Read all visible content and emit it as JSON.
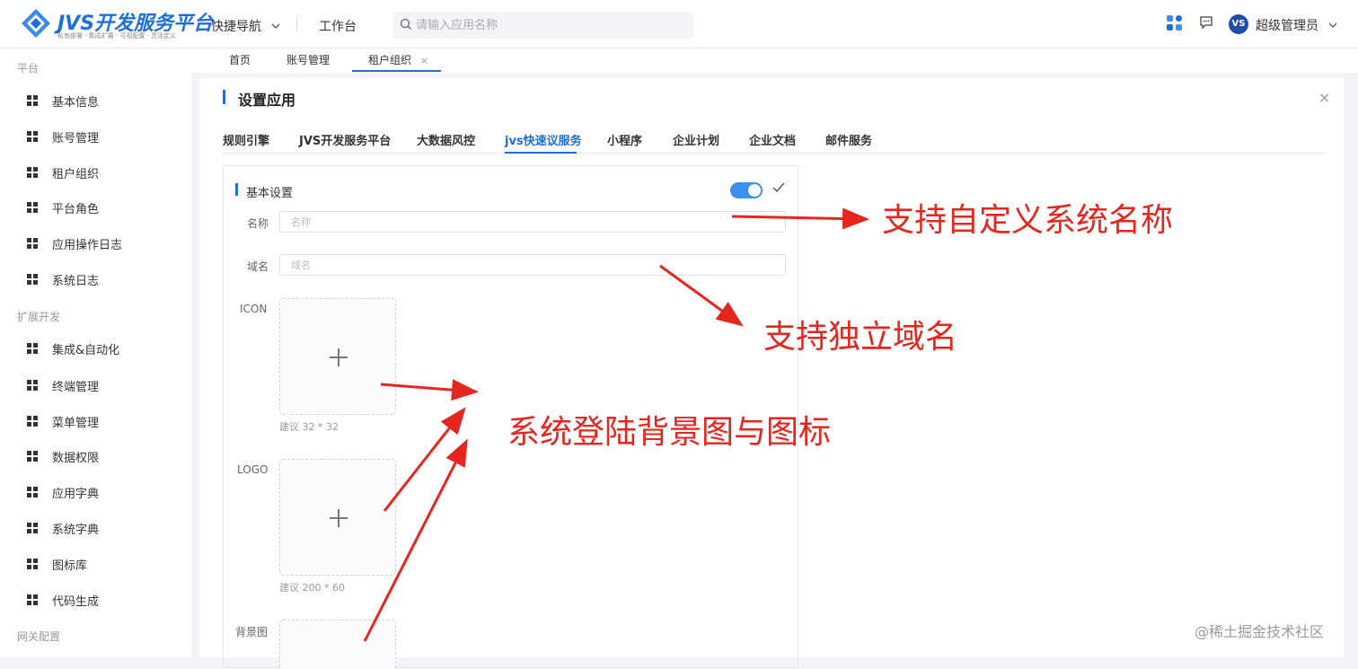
{
  "header": {
    "logo_title": "JVS开发服务平台",
    "logo_subtitle": "私有部署 · 集成扩展 · 可视配置 · 灵活定义",
    "quick_nav": "快捷导航",
    "workbench": "工作台",
    "search_placeholder": "请输入应用名称",
    "avatar_text": "VS",
    "username": "超级管理员"
  },
  "sidebar": {
    "groups": [
      "平台",
      "扩展开发",
      "网关配置"
    ],
    "items": [
      "基本信息",
      "账号管理",
      "租户组织",
      "平台角色",
      "应用操作日志",
      "系统日志",
      "集成&自动化",
      "终端管理",
      "菜单管理",
      "数据权限",
      "应用字典",
      "系统字典",
      "图标库",
      "代码生成"
    ]
  },
  "page_tabs": [
    "首页",
    "账号管理",
    "租户组织"
  ],
  "page_tab_close": "×",
  "panel": {
    "title": "设置应用",
    "close": "×",
    "app_tabs": [
      "规则引擎",
      "JVS开发服务平台",
      "大数据风控",
      "jvs快速议服务",
      "小程序",
      "企业计划",
      "企业文档",
      "邮件服务"
    ],
    "active_tab_index": 3
  },
  "card": {
    "title": "基本设置",
    "toggle_on": true,
    "name_label": "名称",
    "name_placeholder": "名称",
    "domain_label": "域名",
    "domain_placeholder": "域名",
    "icon_label": "ICON",
    "icon_hint": "建议 32 * 32",
    "logo_label": "LOGO",
    "logo_hint": "建议 200 * 60",
    "bg_label": "背景图"
  },
  "annotations": {
    "custom_name": "支持自定义系统名称",
    "domain": "支持独立域名",
    "login_bg": "系统登陆背景图与图标",
    "color": "#e5261e"
  },
  "watermark": "@稀土掘金技术社区"
}
